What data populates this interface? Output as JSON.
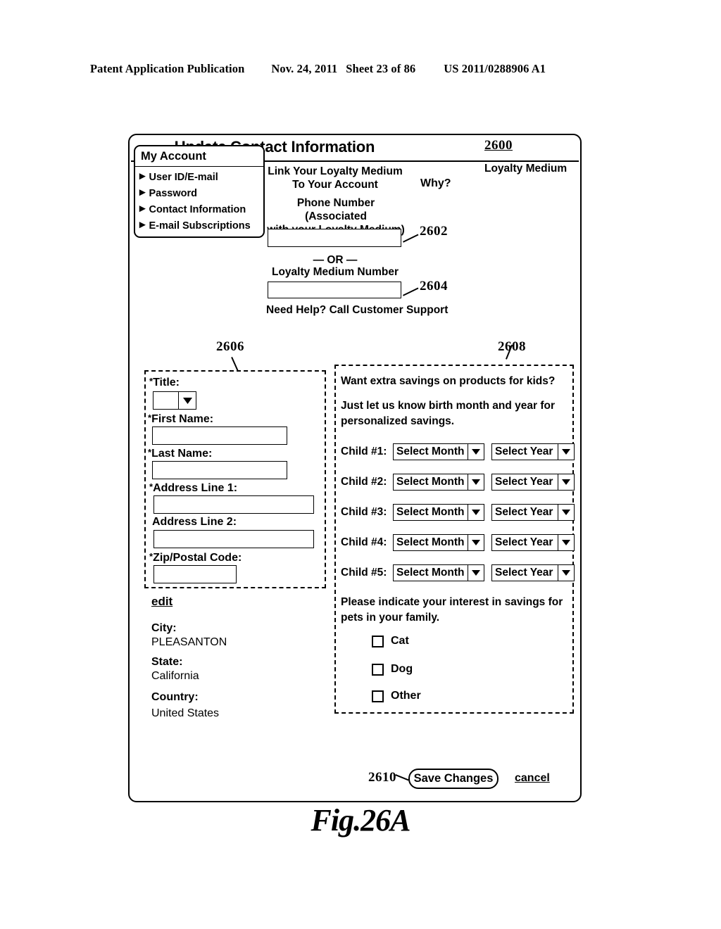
{
  "publication_header": {
    "title": "Patent Application Publication",
    "date": "Nov. 24, 2011",
    "sheet": "Sheet 23 of 86",
    "patent_number": "US 2011/0288906 A1"
  },
  "figure": {
    "caption": "Fig.26A",
    "ref_screen": "2600",
    "ref_phone_field": "2602",
    "ref_loyalty_number_field": "2604",
    "ref_left_panel": "2606",
    "ref_right_panel": "2608",
    "ref_save_button": "2610"
  },
  "screen": {
    "title": "Update Contact Information",
    "sidebar": {
      "title": "My Account",
      "arrow_glyph": "▶",
      "items": [
        {
          "label": "User ID/E-mail"
        },
        {
          "label": "Password"
        },
        {
          "label": "Contact Information"
        },
        {
          "label": "E-mail Subscriptions"
        }
      ]
    },
    "loyalty": {
      "corner_label": "Loyalty Medium",
      "link_heading_line1": "Link Your Loyalty Medium",
      "link_heading_line2": "To Your Account",
      "why_link": "Why?",
      "phone_label_line1": "Phone Number (Associated",
      "phone_label_line2": "with your Loyalty Medium)",
      "phone_value": "",
      "phone_placeholder": "",
      "or_divider": "— OR —",
      "number_label": "Loyalty Medium Number",
      "number_value": "",
      "number_placeholder": "",
      "help_text": "Need Help? Call Customer Support"
    },
    "address_form": {
      "fields": [
        {
          "label": "Title:",
          "required": true,
          "type": "select",
          "value": ""
        },
        {
          "label": "First Name:",
          "required": true,
          "type": "text",
          "value": ""
        },
        {
          "label": "Last Name:",
          "required": true,
          "type": "text",
          "value": ""
        },
        {
          "label": "Address Line 1:",
          "required": true,
          "type": "text",
          "value": ""
        },
        {
          "label": "Address Line 2:",
          "required": false,
          "type": "text",
          "value": ""
        },
        {
          "label": "Zip/Postal Code:",
          "required": true,
          "type": "text",
          "value": ""
        }
      ],
      "required_marker": "*",
      "edit_link": "edit",
      "readonly": [
        {
          "label": "City:",
          "value": "PLEASANTON"
        },
        {
          "label": "State:",
          "value": "California"
        },
        {
          "label": "Country:",
          "value": "United States"
        }
      ]
    },
    "kids": {
      "question": "Want extra savings on products for kids?",
      "subtext": "Just let us know birth month and year for personalized savings.",
      "month_placeholder": "Select Month",
      "year_placeholder": "Select Year",
      "rows": [
        {
          "label": "Child #1:",
          "month": "Select Month",
          "year": "Select Year"
        },
        {
          "label": "Child #2:",
          "month": "Select Month",
          "year": "Select Year"
        },
        {
          "label": "Child #3:",
          "month": "Select Month",
          "year": "Select Year"
        },
        {
          "label": "Child #4:",
          "month": "Select Month",
          "year": "Select Year"
        },
        {
          "label": "Child #5:",
          "month": "Select Month",
          "year": "Select Year"
        }
      ]
    },
    "pets": {
      "question": "Please indicate your interest in savings for pets in your family.",
      "options": [
        {
          "label": "Cat",
          "checked": false
        },
        {
          "label": "Dog",
          "checked": false
        },
        {
          "label": "Other",
          "checked": false
        }
      ]
    },
    "actions": {
      "save_label": "Save Changes",
      "cancel_label": "cancel"
    }
  }
}
